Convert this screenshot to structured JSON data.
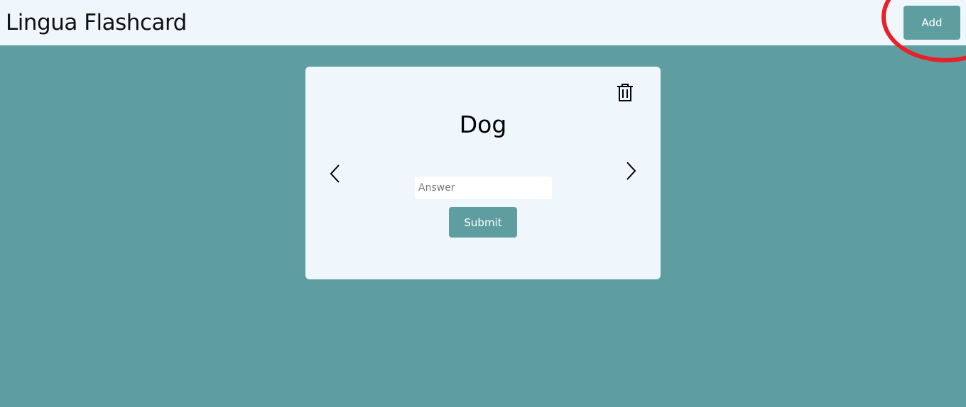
{
  "header": {
    "title": "Lingua Flashcard",
    "add_label": "Add"
  },
  "card": {
    "word": "Dog",
    "answer_value": "",
    "answer_placeholder": "Answer",
    "submit_label": "Submit"
  },
  "icons": {
    "delete": "trash-icon",
    "prev": "chevron-left-icon",
    "next": "chevron-right-icon"
  },
  "colors": {
    "background": "#5f9ea0",
    "surface": "#eff7fd",
    "accent": "#5f9ea0",
    "highlight": "#e8202a"
  }
}
